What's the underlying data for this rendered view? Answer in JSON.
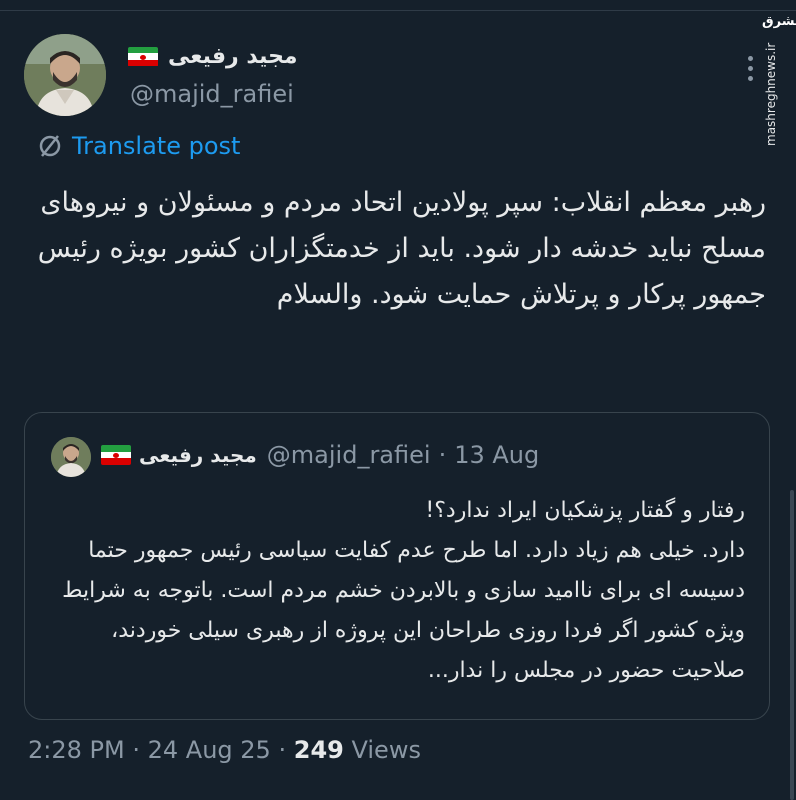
{
  "author": {
    "name": "مجید رفیعی",
    "handle": "@majid_rafiei"
  },
  "translate_label": "Translate post",
  "tweet_text": "رهبر معظم انقلاب: سپر پولادین اتحاد مردم و مسئولان و نیروهای مسلح نباید خدشه دار شود. باید از خدمتگزاران کشور بویژه رئیس جمهور پرکار و پرتلاش حمایت شود. والسلام",
  "quoted": {
    "name": "مجید رفیعی",
    "handle": "@majid_rafiei",
    "separator": "·",
    "date": "13 Aug",
    "text": "رفتار و گفتار پزشکیان ایراد ندارد؟!\nدارد. خیلی هم زیاد دارد. اما طرح عدم کفایت سیاسی رئیس جمهور حتما دسیسه ای برای ناامید سازی و بالابردن خشم مردم است. باتوجه به شرایط ویژه کشور اگر فردا روزی طراحان این پروژه از رهبری سیلی خوردند، صلاحیت حضور در مجلس را ندار..."
  },
  "meta": {
    "time": "2:28 PM",
    "date": "24 Aug 25",
    "separator": "·",
    "views_count": "249",
    "views_label": "Views"
  },
  "watermark": {
    "logo": "مشرق",
    "site": "mashreghnews.ir"
  },
  "colors": {
    "background": "#15202b",
    "accent": "#1d9bf0",
    "secondary_text": "#8b98a5"
  },
  "icons": [
    "translate-icon",
    "more-icon",
    "iran-flag-icon"
  ]
}
